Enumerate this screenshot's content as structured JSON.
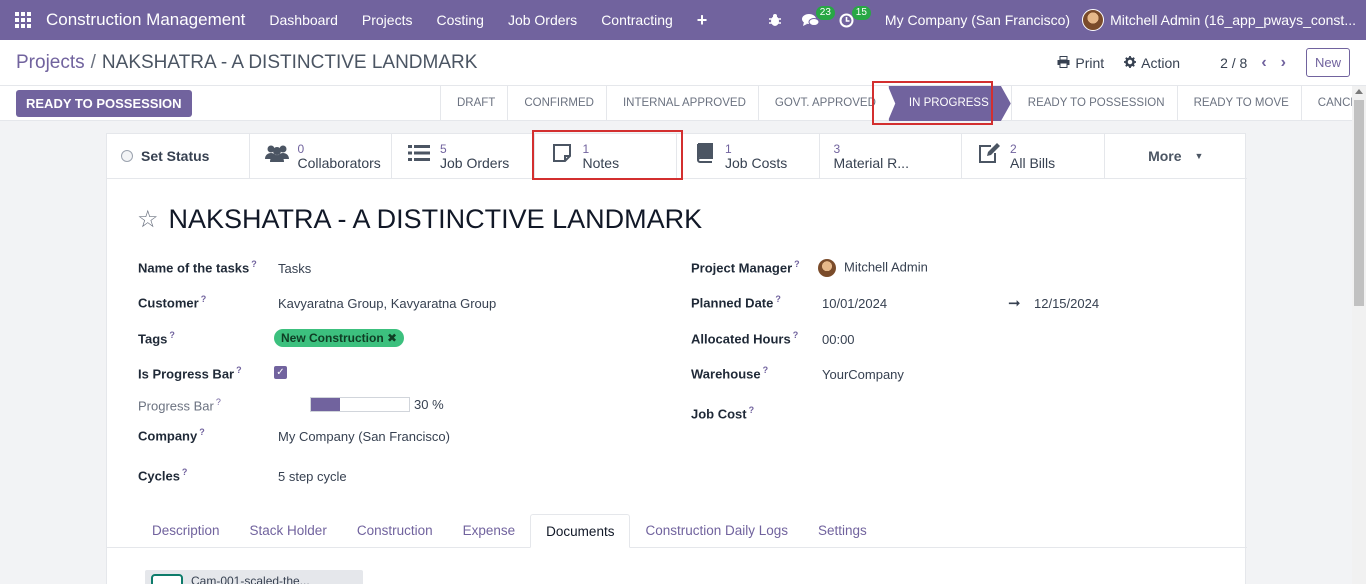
{
  "navbar": {
    "app_title": "Construction Management",
    "menu": [
      "Dashboard",
      "Projects",
      "Costing",
      "Job Orders",
      "Contracting"
    ],
    "messages_count": "23",
    "activities_count": "15",
    "company": "My Company (San Francisco)",
    "user": "Mitchell Admin (16_app_pways_const..."
  },
  "control_panel": {
    "breadcrumb_parent": "Projects",
    "breadcrumb_separator": "/",
    "breadcrumb_current": "NAKSHATRA - A DISTINCTIVE LANDMARK",
    "print_label": "Print",
    "action_label": "Action",
    "pager": "2 / 8",
    "new_label": "New"
  },
  "statusbar": {
    "action_button": "READY TO POSSESSION",
    "stages": [
      "DRAFT",
      "CONFIRMED",
      "INTERNAL APPROVED",
      "GOVT. APPROVED",
      "IN PROGRESS",
      "READY TO POSSESSION",
      "READY TO MOVE",
      "CANCELED"
    ],
    "active_stage": "IN PROGRESS"
  },
  "smart_buttons": {
    "set_status": "Set Status",
    "collaborators": {
      "count": "0",
      "label": "Collaborators"
    },
    "job_orders": {
      "count": "5",
      "label": "Job Orders"
    },
    "notes": {
      "count": "1",
      "label": "Notes"
    },
    "job_costs": {
      "count": "1",
      "label": "Job Costs"
    },
    "material": {
      "count": "3",
      "label": "Material R..."
    },
    "bills": {
      "count": "2",
      "label": "All Bills"
    },
    "more": "More"
  },
  "record": {
    "title": "NAKSHATRA - A DISTINCTIVE LANDMARK",
    "name_of_tasks_label": "Name of the tasks",
    "name_of_tasks": "Tasks",
    "customer_label": "Customer",
    "customer": "Kavyaratna Group, Kavyaratna Group",
    "tags_label": "Tags",
    "tag": "New Construction",
    "is_progress_bar_label": "Is Progress Bar",
    "is_progress_bar": true,
    "progress_bar_label": "Progress Bar",
    "progress_value": 30,
    "progress_text": "30 %",
    "company_label": "Company",
    "company": "My Company (San Francisco)",
    "cycles_label": "Cycles",
    "cycles": "5 step cycle",
    "project_manager_label": "Project Manager",
    "project_manager": "Mitchell Admin",
    "planned_date_label": "Planned Date",
    "planned_start": "10/01/2024",
    "planned_end": "12/15/2024",
    "allocated_hours_label": "Allocated Hours",
    "allocated_hours": "00:00",
    "warehouse_label": "Warehouse",
    "warehouse": "YourCompany",
    "job_cost_label": "Job Cost",
    "help_mark": "?"
  },
  "tabs": [
    "Description",
    "Stack Holder",
    "Construction",
    "Expense",
    "Documents",
    "Construction Daily Logs",
    "Settings"
  ],
  "active_tab": "Documents",
  "documents": [
    {
      "name": "Cam-001-scaled-the..."
    }
  ],
  "colors": {
    "brand": "#71639e",
    "highlight": "#d32f2f",
    "tag": "#3cc07e"
  }
}
